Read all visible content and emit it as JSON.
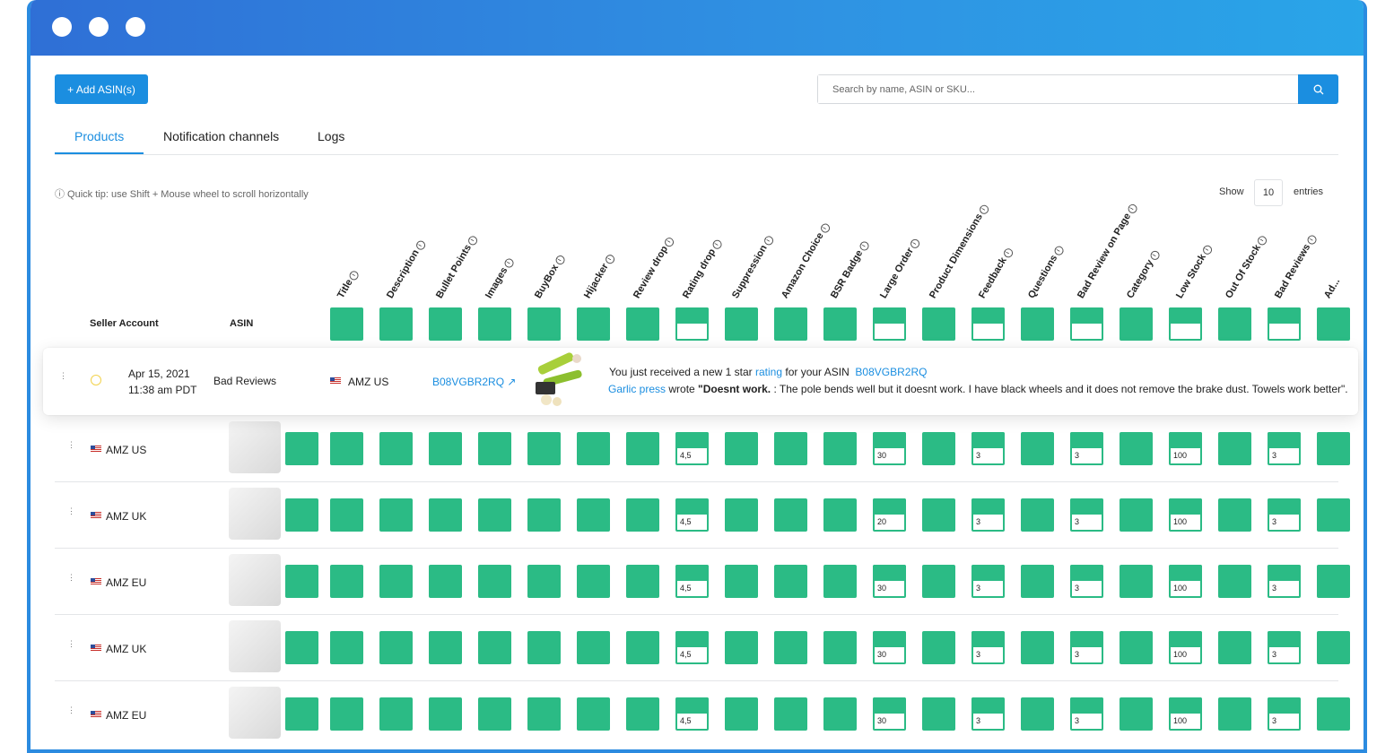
{
  "toolbar": {
    "add_label": "+ Add ASIN(s)",
    "search_placeholder": "Search by name, ASIN or SKU..."
  },
  "tabs": [
    {
      "label": "Products",
      "active": true
    },
    {
      "label": "Notification channels",
      "active": false
    },
    {
      "label": "Logs",
      "active": false
    }
  ],
  "tip": "ⓘ Quick tip: use Shift + Mouse wheel to scroll horizontally",
  "entries": {
    "show_label": "Show",
    "value": "10",
    "suffix": "entries"
  },
  "table": {
    "seller_header": "Seller Account",
    "asin_header": "ASIN",
    "columns": [
      "Title",
      "Description",
      "Bullet Points",
      "Images",
      "BuyBox",
      "Hijacker",
      "Review drop",
      "Rating drop",
      "Suppression",
      "Amazon Choice",
      "BSR Badge",
      "Large Order",
      "Product Dimensions",
      "Feedback",
      "Questions",
      "Bad Review on Page",
      "Category",
      "Low Stock",
      "Out Of Stock",
      "Bad Reviews",
      "Ad..."
    ],
    "rows": [
      {
        "market": "AMZ US",
        "values": [
          "4,5",
          "30",
          "3",
          "3",
          "100",
          "3"
        ]
      },
      {
        "market": "AMZ UK",
        "values": [
          "4,5",
          "20",
          "3",
          "3",
          "100",
          "3"
        ]
      },
      {
        "market": "AMZ EU",
        "values": [
          "4,5",
          "30",
          "3",
          "3",
          "100",
          "3"
        ]
      },
      {
        "market": "AMZ UK",
        "values": [
          "4,5",
          "30",
          "3",
          "3",
          "100",
          "3"
        ]
      },
      {
        "market": "AMZ EU",
        "values": [
          "4,5",
          "30",
          "3",
          "3",
          "100",
          "3"
        ]
      }
    ]
  },
  "notification": {
    "date": "Apr 15, 2021",
    "time": "11:38 am PDT",
    "type": "Bad Reviews",
    "market": "AMZ US",
    "asin": "B08VGBR2RQ",
    "msg_prefix": "You just received a new 1 star",
    "msg_rating": "rating",
    "msg_middle": "for your ASIN",
    "msg_asin": "B08VGBR2RQ",
    "product": "Garlic press",
    "wrote": "wrote",
    "quote_bold": "\"Doesnt work.",
    "quote_rest": ": The pole bends well but it doesnt work. I have black wheels and it does not remove the brake dust. Towels work better\"."
  },
  "colors": {
    "accent": "#1b8ee0",
    "status_green": "#2bbb85"
  }
}
